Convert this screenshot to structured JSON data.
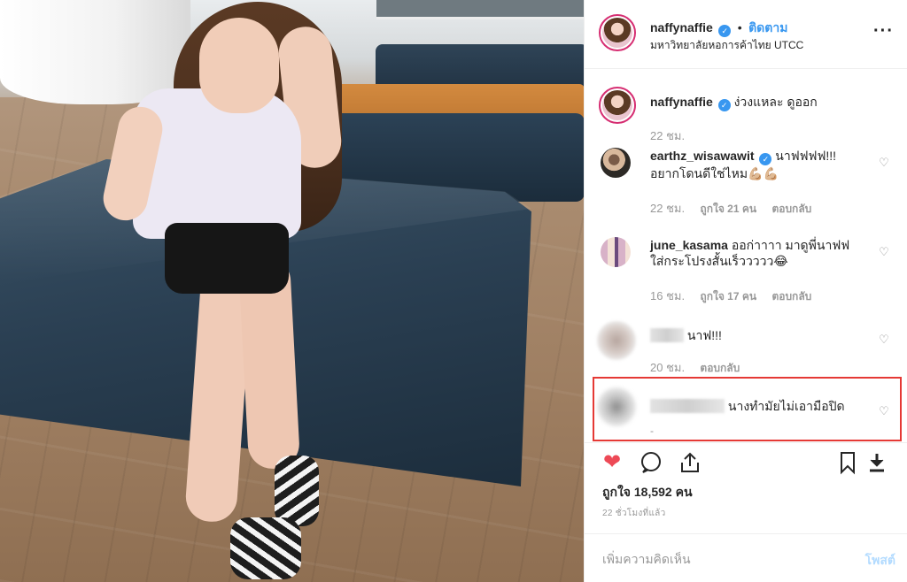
{
  "header": {
    "username": "naffynaffie",
    "follow_label": "ติดตาม",
    "separator": "•",
    "location": "มหาวิทยาลัยหอการค้าไทย UTCC",
    "more_icon": "more-horizontal-icon",
    "verified_icon": "verified-badge-icon"
  },
  "caption": {
    "username": "naffynaffie",
    "text": "ง่วงแหละ ดูออก",
    "time": "22 ชม."
  },
  "comments": [
    {
      "username": "earthz_wisawawit",
      "verified": true,
      "text": "นาฟฟฟฟ!!! อยากโดนดีใช่ไหม💪🏼💪🏼",
      "time": "22 ชม.",
      "likes": "ถูกใจ 21 คน",
      "reply": "ตอบกลับ"
    },
    {
      "username": "june_kasama",
      "text": "ออก่าาาา มาดูพี่นาฟฟ ใส่กระโปรงสั้นเร็ววววว😂",
      "time": "16 ชม.",
      "likes": "ถูกใจ 17 คน",
      "reply": "ตอบกลับ"
    },
    {
      "username_blurred": true,
      "text": "นาฟ!!!",
      "time": "20 ชม.",
      "reply": "ตอบกลับ"
    },
    {
      "username_blurred": true,
      "text": "นางทำมัยไม่เอามือปิด",
      "meta": "-"
    }
  ],
  "actions": {
    "like_icon": "heart-filled-icon",
    "comment_icon": "comment-icon",
    "share_icon": "share-icon",
    "save_icon": "bookmark-icon",
    "download_icon": "download-icon"
  },
  "likes_count": "ถูกใจ 18,592 คน",
  "time_ago": "22 ชั่วโมงที่แล้ว",
  "add_comment": {
    "placeholder": "เพิ่มความคิดเห็น",
    "post_label": "โพสต์"
  },
  "colors": {
    "link_blue": "#3897f0",
    "like_red": "#ed4956",
    "highlight_red": "#e53935",
    "muted_gray": "#999999"
  }
}
